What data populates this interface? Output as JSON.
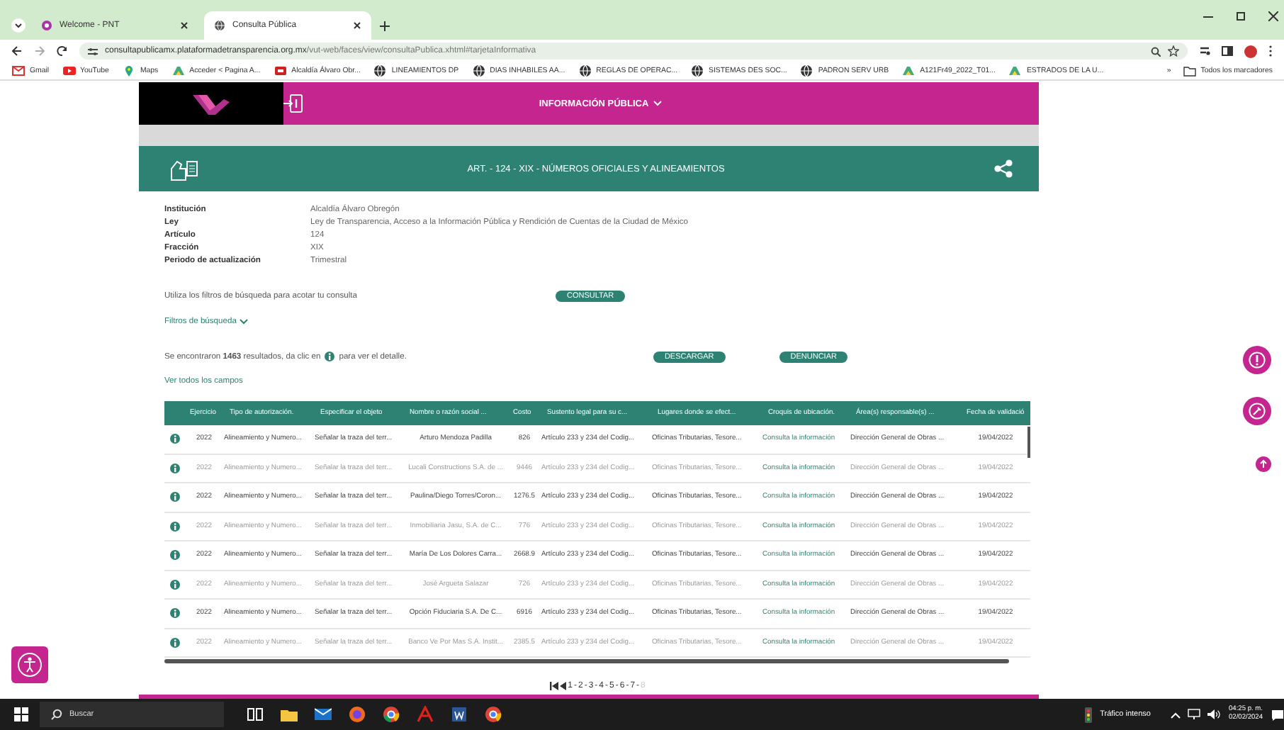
{
  "browser": {
    "tabs": [
      {
        "title": "Welcome - PNT",
        "selected": false
      },
      {
        "title": "Consulta Pública",
        "selected": true
      }
    ],
    "url_host": "consultapublicamx.plataformadetransparencia.org.mx",
    "url_path": "/vut-web/faces/view/consultaPublica.xhtml#tarjetaInformativa",
    "bookmarks": [
      {
        "label": "Gmail",
        "kind": "mail"
      },
      {
        "label": "YouTube",
        "kind": "video"
      },
      {
        "label": "Maps",
        "kind": "pin"
      },
      {
        "label": "Acceder < Pagina A...",
        "kind": "drive"
      },
      {
        "label": "Alcaldía Álvaro Obr...",
        "kind": "badge"
      },
      {
        "label": "LINEAMIENTOS DP",
        "kind": "globe"
      },
      {
        "label": "DIAS INHABILES AA...",
        "kind": "globe"
      },
      {
        "label": "REGLAS DE OPERAC...",
        "kind": "globe"
      },
      {
        "label": "SISTEMAS DES SOC...",
        "kind": "globe"
      },
      {
        "label": "PADRON SERV URB",
        "kind": "globe"
      },
      {
        "label": "A121Fr49_2022_T01...",
        "kind": "drive"
      },
      {
        "label": "ESTRADOS DE LA U...",
        "kind": "drive"
      }
    ],
    "more_bookmarks": "»",
    "all_bookmarks": "Todos los marcadores"
  },
  "header": {
    "menu": "INFORMACIÓN PÚBLICA"
  },
  "title_bar": {
    "title": "ART. - 124 - XIX - NÚMEROS OFICIALES Y ALINEAMIENTOS"
  },
  "details": [
    {
      "label": "Institución",
      "value": "Alcaldía Álvaro Obregón"
    },
    {
      "label": "Ley",
      "value": "Ley de Transparencia, Acceso a la Información Pública y Rendición de Cuentas de la Ciudad de México"
    },
    {
      "label": "Artículo",
      "value": "124"
    },
    {
      "label": "Fracción",
      "value": "XIX"
    },
    {
      "label": "Periodo de actualización",
      "value": "Trimestral"
    }
  ],
  "filter_hint": "Utiliza los filtros de búsqueda para acotar tu consulta",
  "consult_button": "CONSULTAR",
  "filters_link": "Filtros de búsqueda",
  "results_before": "Se encontraron **1463** resultados, da clic en",
  "results_after": "para ver el detalle.",
  "download_button": "DESCARGAR",
  "report_button": "DENUNCIAR",
  "show_all_link": "Ver todos los campos",
  "table": {
    "columns": [
      "Ejercicio",
      "Tipo de autorización.",
      "Especificar el objeto",
      "Nombre o razón social ...",
      "Costo",
      "Sustento legal para su c...",
      "Lugares donde se efect...",
      "Croquis de ubicación.",
      "Área(s) responsable(s) ...",
      "Fecha de validació"
    ],
    "rows": [
      [
        "2022",
        "Alineamiento y Numero...",
        "Señalar la traza del terr...",
        "Arturo Mendoza Padilla",
        "826",
        "Artículo 233 y 234 del Codig...",
        "Oficinas Tributarias, Tesore...",
        "Consulta la información",
        "Dirección General de Obras ...",
        "19/04/2022"
      ],
      [
        "2022",
        "Alineamiento y Numero...",
        "Señalar la traza del terr...",
        "Lucali Constructions S.A. de ...",
        "9446",
        "Artículo 233 y 234 del Codig...",
        "Oficinas Tributarias, Tesore...",
        "Consulta la información",
        "Dirección General de Obras ...",
        "19/04/2022"
      ],
      [
        "2022",
        "Alineamiento y Numero...",
        "Señalar la traza del terr...",
        "Paulina/Diego Torres/Coron...",
        "1276.5",
        "Artículo 233 y 234 del Codig...",
        "Oficinas Tributarias, Tesore...",
        "Consulta la información",
        "Dirección General de Obras ...",
        "19/04/2022"
      ],
      [
        "2022",
        "Alineamiento y Numero...",
        "Señalar la traza del terr...",
        "Inmobiliaria Jasu, S.A. de C...",
        "776",
        "Artículo 233 y 234 del Codig...",
        "Oficinas Tributarias, Tesore...",
        "Consulta la información",
        "Dirección General de Obras ...",
        "19/04/2022"
      ],
      [
        "2022",
        "Alineamiento y Numero...",
        "Señalar la traza del terr...",
        "María De Los Dolores Carra...",
        "2668.9",
        "Artículo 233 y 234 del Codig...",
        "Oficinas Tributarias, Tesore...",
        "Consulta la información",
        "Dirección General de Obras ...",
        "19/04/2022"
      ],
      [
        "2022",
        "Alineamiento y Numero...",
        "Señalar la traza del terr...",
        "José Argueta Salazar",
        "726",
        "Artículo 233 y 234 del Codig...",
        "Oficinas Tributarias, Tesore...",
        "Consulta la información",
        "Dirección General de Obras ...",
        "19/04/2022"
      ],
      [
        "2022",
        "Alineamiento y Numero...",
        "Señalar la traza del terr...",
        "Opción Fiduciaria S.A. De C...",
        "6916",
        "Artículo 233 y 234 del Codig...",
        "Oficinas Tributarias, Tesore...",
        "Consulta la información",
        "Dirección General de Obras ...",
        "19/04/2022"
      ],
      [
        "2022",
        "Alineamiento y Numero...",
        "Señalar la traza del terr...",
        "Banco Ve Por Mas S.A. Instit...",
        "2385.5",
        "Artículo 233 y 234 del Codig...",
        "Oficinas Tributarias, Tesore...",
        "Consulta la información",
        "Dirección General de Obras ...",
        "19/04/2022"
      ]
    ]
  },
  "pagination": {
    "separator": "-",
    "pages": [
      {
        "label": "1",
        "dimmed": false
      },
      {
        "label": "2",
        "dimmed": false
      },
      {
        "label": "3",
        "dimmed": false
      },
      {
        "label": "4",
        "dimmed": false
      },
      {
        "label": "5",
        "dimmed": false
      },
      {
        "label": "6",
        "dimmed": false
      },
      {
        "label": "7",
        "dimmed": false
      },
      {
        "label": "8",
        "dimmed": true
      }
    ]
  },
  "taskbar": {
    "search": "Buscar",
    "weather": "Tráfico intenso",
    "time": "04:25 p. m.",
    "date": "02/02/2024"
  }
}
